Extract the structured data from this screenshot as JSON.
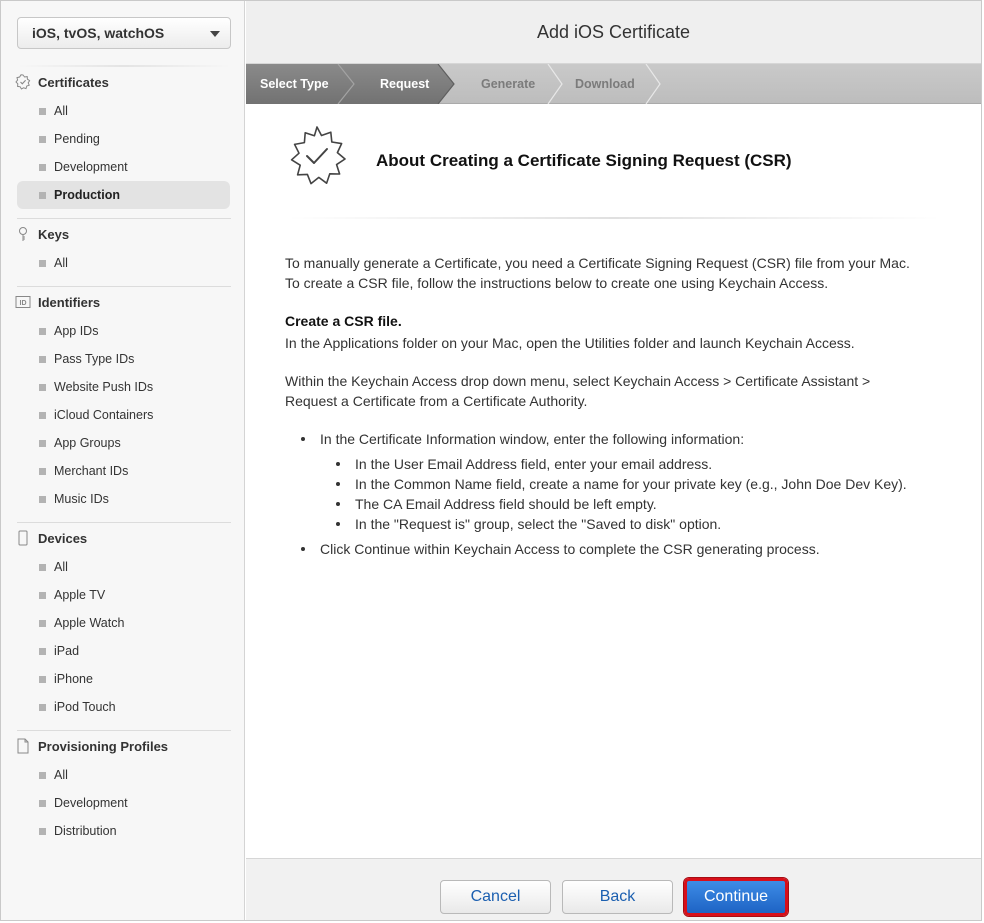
{
  "platform": {
    "selected": "iOS, tvOS, watchOS"
  },
  "sidebar": {
    "certificates": {
      "title": "Certificates",
      "items": [
        "All",
        "Pending",
        "Development",
        "Production"
      ]
    },
    "keys": {
      "title": "Keys",
      "items": [
        "All"
      ]
    },
    "identifiers": {
      "title": "Identifiers",
      "items": [
        "App IDs",
        "Pass Type IDs",
        "Website Push IDs",
        "iCloud Containers",
        "App Groups",
        "Merchant IDs",
        "Music IDs"
      ]
    },
    "devices": {
      "title": "Devices",
      "items": [
        "All",
        "Apple TV",
        "Apple Watch",
        "iPad",
        "iPhone",
        "iPod Touch"
      ]
    },
    "profiles": {
      "title": "Provisioning Profiles",
      "items": [
        "All",
        "Development",
        "Distribution"
      ]
    },
    "active_item": "Production"
  },
  "header": {
    "title": "Add iOS Certificate"
  },
  "steps": [
    "Select Type",
    "Request",
    "Generate",
    "Download"
  ],
  "content": {
    "title": "About Creating a Certificate Signing Request (CSR)",
    "intro": "To manually generate a Certificate, you need a Certificate Signing Request (CSR) file from your Mac. To create a CSR file, follow the instructions below to create one using Keychain Access.",
    "csr_heading": "Create a CSR file.",
    "csr_text": "In the Applications folder on your Mac, open the Utilities folder and launch Keychain Access.",
    "menu_text": "Within the Keychain Access drop down menu, select Keychain Access > Certificate Assistant > Request a Certificate from a Certificate Authority.",
    "bullet1": "In the Certificate Information window, enter the following information:",
    "sub_bullets": [
      "In the User Email Address field, enter your email address.",
      "In the Common Name field, create a name for your private key (e.g., John Doe Dev Key).",
      "The CA Email Address field should be left empty.",
      "In the \"Request is\" group, select the \"Saved to disk\" option."
    ],
    "bullet2": "Click Continue within Keychain Access to complete the CSR generating process."
  },
  "footer": {
    "cancel": "Cancel",
    "back": "Back",
    "continue": "Continue"
  },
  "colors": {
    "accent": "#1e63c4",
    "highlight_border": "#d80f1a",
    "step_active": "#7d7d7d"
  }
}
